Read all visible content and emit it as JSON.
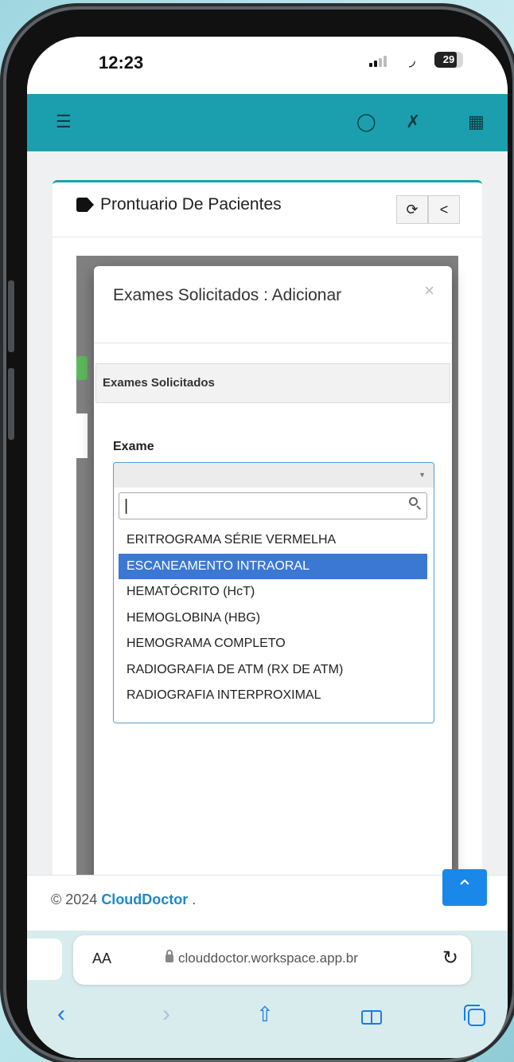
{
  "status_bar": {
    "time": "12:23",
    "battery": "29"
  },
  "app_header": {
    "menu_icon": "hamburger-icon",
    "user_icon": "user-icon",
    "compress_icon": "compress-icon",
    "grid_icon": "grid-icon"
  },
  "card": {
    "title": "Prontuario De Pacientes",
    "refresh_label": "⟳",
    "back_label": "<"
  },
  "modal": {
    "title": "Exames Solicitados : Adicionar",
    "close_label": "×",
    "panel_heading": "Exames Solicitados",
    "field_label": "Exame",
    "search_value": "|",
    "options": [
      "ERITROGRAMA SÉRIE VERMELHA",
      "ESCANEAMENTO INTRAORAL",
      "HEMATÓCRITO (HcT)",
      "HEMOGLOBINA (HBG)",
      "HEMOGRAMA COMPLETO",
      "RADIOGRAFIA DE ATM (RX DE ATM)",
      "RADIOGRAFIA INTERPROXIMAL"
    ],
    "highlighted_option": "ESCANEAMENTO INTRAORAL"
  },
  "footer": {
    "copyright": "© 2024 ",
    "brand": "CloudDoctor",
    "suffix": " ."
  },
  "browser": {
    "text_size_label": "AA",
    "url": "clouddoctor.workspace.app.br"
  },
  "colors": {
    "header": "#1b9fae",
    "selection": "#3b78d4",
    "brand": "#1e88c9",
    "scroll_button": "#1a88e8"
  }
}
